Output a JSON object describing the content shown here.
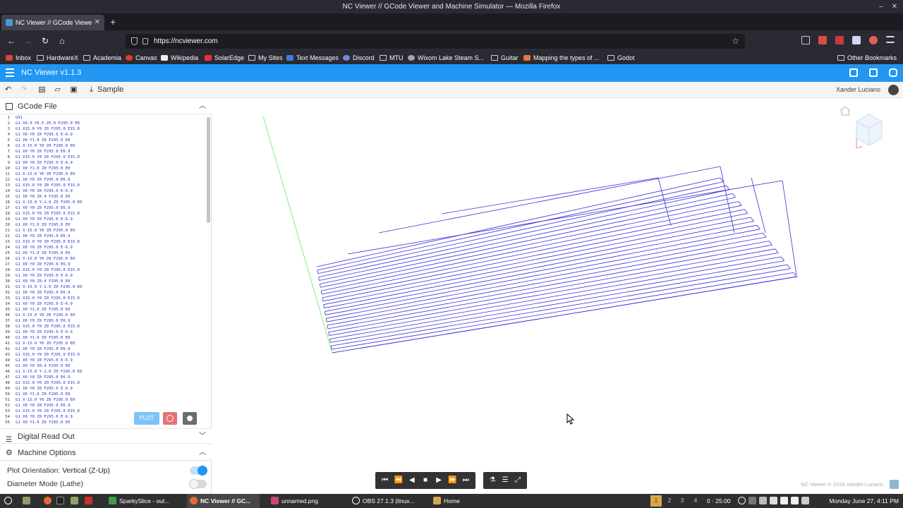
{
  "window": {
    "title": "NC Viewer // GCode Viewer and Machine Simulator — Mozilla Firefox"
  },
  "browser": {
    "tab_title": "NC Viewer // GCode Viewe",
    "url": "https://ncviewer.com",
    "bookmarks": [
      {
        "label": "Inbox",
        "icon": "gmail-icon"
      },
      {
        "label": "HardwareX",
        "icon": "folder-icon"
      },
      {
        "label": "Academia",
        "icon": "folder-icon"
      },
      {
        "label": "Canvas",
        "icon": "canvas-icon"
      },
      {
        "label": "Wikipedia",
        "icon": "wikipedia-icon"
      },
      {
        "label": "SolarEdge",
        "icon": "solaredge-icon"
      },
      {
        "label": "My Sites",
        "icon": "folder-icon"
      },
      {
        "label": "Text Messages",
        "icon": "messages-icon"
      },
      {
        "label": "Discord",
        "icon": "discord-icon"
      },
      {
        "label": "MTU",
        "icon": "folder-icon"
      },
      {
        "label": "Wixom Lake Steam S...",
        "icon": "wixom-icon"
      },
      {
        "label": "Guitar",
        "icon": "folder-icon"
      },
      {
        "label": "Mapping the types of ...",
        "icon": "page-icon"
      },
      {
        "label": "Godot",
        "icon": "folder-icon"
      }
    ],
    "other_bookmarks": "Other Bookmarks"
  },
  "app": {
    "title": "NC Viewer  v1.1.3",
    "sample_label": "Sample",
    "user_name": "Xander Luciano",
    "accent_color": "#2196f3"
  },
  "gcode_panel": {
    "title": "GCode File",
    "lines": [
      "G91",
      "G1 X0.0 Y0.5 Z0.0 F295.0 E0",
      "G1 X15.0 Y0 Z0 F295.0 E15.0",
      "G1 X0 Y0 Z0 F295.0 E-6.9",
      "G1 X0 Y1.0 Z0 F295.0 E0",
      "G1 X-15.0 Y0 Z0 F295.0 E0",
      "G1 X0 Y0 Z0 F295.0 E6.9",
      "G1 X15.0 Y0 Z0 F295.0 E15.0",
      "G1 X0 Y0 Z0 F295.0 E-6.9",
      "G1 X0 Y1.0 Z0 F295.0 E0",
      "G1 X-15.0 Y0 Z0 F295.0 E0",
      "G1 X0 Y0 Z0 F295.0 E6.9",
      "G1 X15.0 Y0 Z0 F295.0 E15.0",
      "G1 X0 Y0 Z0 F295.0 E-6.9",
      "G1 X0 Y0 Z0.4 F295.0 E0",
      "G1 X-15.0 Y-2.0 Z0 F295.0 E0",
      "G1 X0 Y0 Z0 F295.0 E6.9",
      "G1 X15.0 Y0 Z0 F295.0 E15.0",
      "G1 X0 Y0 Z0 F295.0 E-6.9",
      "G1 X0 Y1.0 Z0 F295.0 E0",
      "G1 X-15.0 Y0 Z0 F295.0 E0",
      "G1 X0 Y0 Z0 F295.0 E6.9",
      "G1 X15.0 Y0 Z0 F295.0 E15.0",
      "G1 X0 Y0 Z0 F295.0 E-6.9",
      "G1 X0 Y1.0 Z0 F295.0 E0",
      "G1 X-15.0 Y0 Z0 F295.0 E0",
      "G1 X0 Y0 Z0 F295.0 E6.9",
      "G1 X15.0 Y0 Z0 F295.0 E15.0",
      "G1 X0 Y0 Z0 F295.0 E-6.9",
      "G1 X0 Y0 Z0.4 F295.0 E0",
      "G1 X-15.0 Y-2.0 Z0 F295.0 E0",
      "G1 X0 Y0 Z0 F295.0 E6.9",
      "G1 X15.0 Y0 Z0 F295.0 E15.0",
      "G1 X0 Y0 Z0 F295.0 E-6.9",
      "G1 X0 Y1.0 Z0 F295.0 E0",
      "G1 X-15.0 Y0 Z0 F295.0 E0",
      "G1 X0 Y0 Z0 F295.0 E6.9",
      "G1 X15.0 Y0 Z0 F295.0 E15.0",
      "G1 X0 Y0 Z0 F295.0 E-6.9",
      "G1 X0 Y1.0 Z0 F295.0 E0",
      "G1 X-15.0 Y0 Z0 F295.0 E0",
      "G1 X0 Y0 Z0 F295.0 E6.9",
      "G1 X15.0 Y0 Z0 F295.0 E15.0",
      "G1 X0 Y0 Z0 F295.0 E-6.9",
      "G1 X0 Y0 Z0.4 F295.0 E0",
      "G1 X-15.0 Y-2.0 Z0 F295.0 E0",
      "G1 X0 Y0 Z0 F295.0 E6.9",
      "G1 X15.0 Y0 Z0 F295.0 E15.0",
      "G1 X0 Y0 Z0 F295.0 E-6.9",
      "G1 X0 Y1.0 Z0 F295.0 E0",
      "G1 X-15.0 Y0 Z0 F295.0 E0",
      "G1 X0 Y0 Z0 F295.0 E6.9",
      "G1 X15.0 Y0 Z0 F295.0 E15.0",
      "G1 X0 Y0 Z0 F295.0 E-6.9",
      "G1 X0 Y1.0 Z0 F295.0 E0"
    ],
    "plot_label": "PLOT"
  },
  "dro_panel": {
    "title": "Digital Read Out"
  },
  "machine_panel": {
    "title": "Machine Options",
    "plot_orientation_label": "Plot Orientation:",
    "plot_orientation_value": "Vertical (Z-Up)",
    "plot_orientation_on": true,
    "diameter_mode_label": "Diameter Mode (Lathe)",
    "diameter_mode_on": false
  },
  "viewport": {
    "copyright": "NC Viewer © 2018 Xander Luciano",
    "path_color": "#3a2fd6",
    "axis_color": "#7cf07c"
  },
  "taskbar": {
    "apps": [
      {
        "label": "SparkySlice - out...",
        "active": false
      },
      {
        "label": "NC Viewer // GC...",
        "active": true
      },
      {
        "label": "unnamed.png",
        "active": false
      },
      {
        "label": "OBS 27.1.3 (linux...",
        "active": false
      },
      {
        "label": "Home",
        "active": false
      }
    ],
    "workspaces": [
      "1",
      "2",
      "3",
      "4"
    ],
    "timer": "0 · 25:00",
    "clock": "Monday June 27, 4:11 PM"
  }
}
